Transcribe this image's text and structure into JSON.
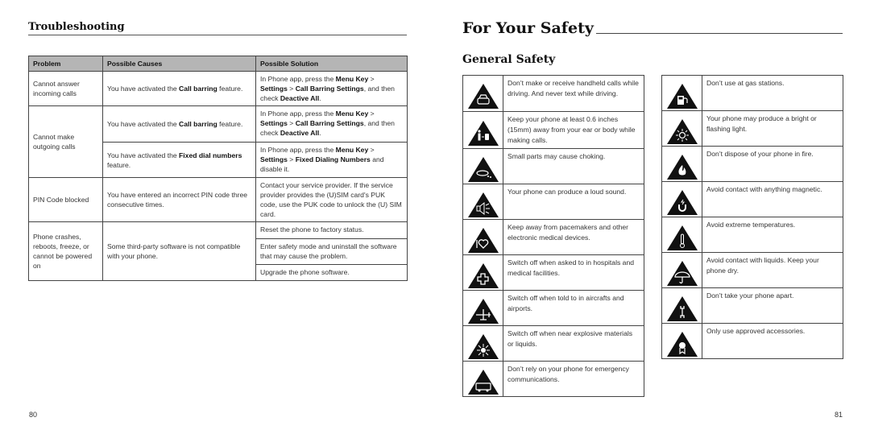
{
  "left_page": {
    "heading": "Troubleshooting",
    "table": {
      "headers": [
        "Problem",
        "Possible Causes",
        "Possible Solution"
      ],
      "rows": [
        {
          "problem": "Cannot answer incoming calls",
          "cause": [
            {
              "t": "You have activated the "
            },
            {
              "b": "Call barring"
            },
            {
              "t": " feature."
            }
          ],
          "solution": [
            {
              "t": "In Phone app, press the "
            },
            {
              "b": "Menu Key"
            },
            {
              "t": " > "
            },
            {
              "b": "Settings"
            },
            {
              "t": " > "
            },
            {
              "b": "Call Barring Settings"
            },
            {
              "t": ", and then check "
            },
            {
              "b": "Deactive All"
            },
            {
              "t": "."
            }
          ]
        },
        {
          "problem": "Cannot make outgoing calls",
          "cause": [
            {
              "t": "You have activated the "
            },
            {
              "b": "Call barring"
            },
            {
              "t": " feature."
            }
          ],
          "solution": [
            {
              "t": "In Phone app, press the "
            },
            {
              "b": "Menu Key"
            },
            {
              "t": " > "
            },
            {
              "b": "Settings"
            },
            {
              "t": " > "
            },
            {
              "b": "Call Barring Settings"
            },
            {
              "t": ", and then check "
            },
            {
              "b": "Deactive All"
            },
            {
              "t": "."
            }
          ]
        },
        {
          "problem": "",
          "cause": [
            {
              "t": "You have activated the "
            },
            {
              "b": "Fixed dial numbers"
            },
            {
              "t": " feature."
            }
          ],
          "solution": [
            {
              "t": "In Phone app, press the "
            },
            {
              "b": "Menu Key"
            },
            {
              "t": " > "
            },
            {
              "b": "Settings"
            },
            {
              "t": " > "
            },
            {
              "b": "Fixed Dialing Numbers"
            },
            {
              "t": " and disable it."
            }
          ]
        },
        {
          "problem": "PIN Code blocked",
          "cause": [
            {
              "t": "You have entered an incorrect PIN code three consecutive times."
            }
          ],
          "solution": [
            {
              "t": "Contact your service provider. If the service provider provides the (U)SIM card's PUK code, use the PUK code to unlock the (U) SIM card."
            }
          ]
        },
        {
          "problem": "Phone crashes, reboots, freeze, or cannot be powered on",
          "cause": [
            {
              "t": "Some third-party software is not compatible with your phone."
            }
          ],
          "solution": [
            {
              "t": "Reset the phone to factory status."
            }
          ]
        },
        {
          "problem": "",
          "cause": [],
          "solution": [
            {
              "t": "Enter safety mode and uninstall the software that may cause the problem."
            }
          ]
        },
        {
          "problem": "",
          "cause": [],
          "solution": [
            {
              "t": "Upgrade the phone software."
            }
          ]
        }
      ]
    },
    "page_number": "80"
  },
  "right_page": {
    "title": "For Your Safety",
    "subtitle": "General Safety",
    "left_items": [
      {
        "icon": "car-icon",
        "text": "Don’t make or receive handheld calls while driving. And never text while driving."
      },
      {
        "icon": "body-distance-icon",
        "text": "Keep your phone at least 0.6 inches (15mm) away from your ear or body while making calls."
      },
      {
        "icon": "choking-icon",
        "text": "Small parts may cause choking."
      },
      {
        "icon": "loud-sound-icon",
        "text": "Your phone can produce a loud sound."
      },
      {
        "icon": "pacemaker-icon",
        "text": "Keep away from pacemakers and other electronic medical devices."
      },
      {
        "icon": "hospital-cross-icon",
        "text": "Switch off when asked to in hospitals and medical facilities."
      },
      {
        "icon": "airplane-icon",
        "text": "Switch off when told to in aircrafts and airports."
      },
      {
        "icon": "explosive-icon",
        "text": "Switch off when near explosive materials or liquids."
      },
      {
        "icon": "ambulance-icon",
        "text": "Don’t rely on your phone for emergency communications."
      }
    ],
    "right_items": [
      {
        "icon": "gas-pump-icon",
        "text": "Don’t use at gas stations."
      },
      {
        "icon": "flashing-light-icon",
        "text": "Your phone may produce a bright or flashing light."
      },
      {
        "icon": "fire-icon",
        "text": "Don’t dispose of your phone in fire."
      },
      {
        "icon": "magnet-icon",
        "text": "Avoid contact with anything magnetic."
      },
      {
        "icon": "thermometer-icon",
        "text": "Avoid extreme temperatures."
      },
      {
        "icon": "umbrella-icon",
        "text": "Avoid contact with liquids. Keep your phone dry."
      },
      {
        "icon": "wrench-icon",
        "text": "Don’t take your phone apart."
      },
      {
        "icon": "approved-badge-icon",
        "text": "Only use approved accessories."
      }
    ],
    "page_number": "81"
  }
}
